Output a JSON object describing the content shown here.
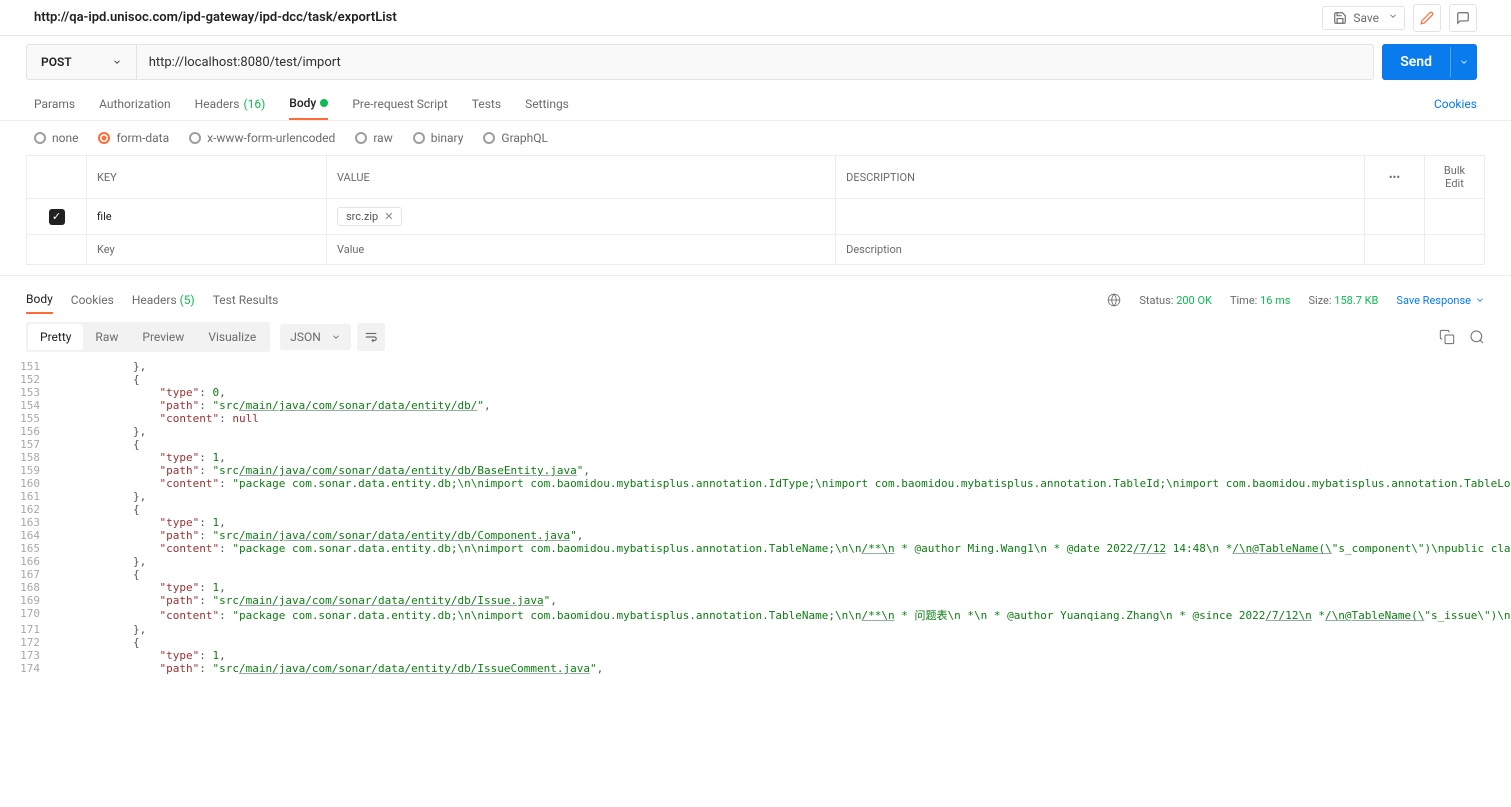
{
  "tab_title": "http://qa-ipd.unisoc.com/ipd-gateway/ipd-dcc/task/exportList",
  "save_button": "Save",
  "method": "POST",
  "url": "http://localhost:8080/test/import",
  "send_button": "Send",
  "request_tabs": {
    "params": "Params",
    "authorization": "Authorization",
    "headers": "Headers",
    "headers_count": "(16)",
    "body": "Body",
    "prerequest": "Pre-request Script",
    "tests": "Tests",
    "settings": "Settings"
  },
  "cookies_link": "Cookies",
  "body_types": {
    "none": "none",
    "formdata": "form-data",
    "urlencoded": "x-www-form-urlencoded",
    "raw": "raw",
    "binary": "binary",
    "graphql": "GraphQL"
  },
  "form_headers": {
    "key": "KEY",
    "value": "VALUE",
    "desc": "DESCRIPTION"
  },
  "bulk_edit": "Bulk Edit",
  "form_rows": [
    {
      "key": "file",
      "file": "src.zip"
    }
  ],
  "placeholders": {
    "key": "Key",
    "value": "Value",
    "desc": "Description"
  },
  "response_tabs": {
    "body": "Body",
    "cookies": "Cookies",
    "headers": "Headers",
    "headers_count": "(5)",
    "tests": "Test Results"
  },
  "status_label": "Status:",
  "status_value": "200 OK",
  "time_label": "Time:",
  "time_value": "16 ms",
  "size_label": "Size:",
  "size_value": "158.7 KB",
  "save_response": "Save Response",
  "view_segments": {
    "pretty": "Pretty",
    "raw": "Raw",
    "preview": "Preview",
    "visualize": "Visualize"
  },
  "format": "JSON",
  "code_lines": [
    {
      "n": 151,
      "indent": 2,
      "type": "close"
    },
    {
      "n": 152,
      "indent": 2,
      "type": "open"
    },
    {
      "n": 153,
      "indent": 3,
      "type": "kv_num",
      "key": "type",
      "val": "0"
    },
    {
      "n": 154,
      "indent": 3,
      "type": "kv_path",
      "key": "path",
      "prefix": "src",
      "underlined": "/main/java/com/sonar/data/entity/db/"
    },
    {
      "n": 155,
      "indent": 3,
      "type": "kv_null",
      "key": "content"
    },
    {
      "n": 156,
      "indent": 2,
      "type": "close"
    },
    {
      "n": 157,
      "indent": 2,
      "type": "open"
    },
    {
      "n": 158,
      "indent": 3,
      "type": "kv_num",
      "key": "type",
      "val": "1"
    },
    {
      "n": 159,
      "indent": 3,
      "type": "kv_path",
      "key": "path",
      "prefix": "src",
      "underlined": "/main/java/com/sonar/data/entity/db/BaseEntity.java"
    },
    {
      "n": 160,
      "indent": 3,
      "type": "kv_str",
      "key": "content",
      "val": "package com.sonar.data.entity.db;\\n\\nimport com.baomidou.mybatisplus.annotation.IdType;\\nimport com.baomidou.mybatisplus.annotation.TableId;\\nimport com.baomidou.mybatisplus.annotation.TableLogic;",
      "trail": true
    },
    {
      "n": 161,
      "indent": 2,
      "type": "close"
    },
    {
      "n": 162,
      "indent": 2,
      "type": "open"
    },
    {
      "n": 163,
      "indent": 3,
      "type": "kv_num",
      "key": "type",
      "val": "1"
    },
    {
      "n": 164,
      "indent": 3,
      "type": "kv_path",
      "key": "path",
      "prefix": "src",
      "underlined": "/main/java/com/sonar/data/entity/db/Component.java"
    },
    {
      "n": 165,
      "indent": 3,
      "type": "kv_content_mixed",
      "key": "content",
      "parts": [
        {
          "t": "s",
          "v": "package com.sonar.data.entity.db;\\n\\nimport com.baomidou.mybatisplus.annotation.TableName;\\n\\n"
        },
        {
          "t": "u",
          "v": "/**\\n"
        },
        {
          "t": "s",
          "v": " * @author Ming.Wang1\\n * @date 2022"
        },
        {
          "t": "u",
          "v": "/7/12"
        },
        {
          "t": "s",
          "v": " 14:48\\n *"
        },
        {
          "t": "u",
          "v": "/\\n@TableName(\\"
        },
        {
          "t": "s",
          "v": "\"s_component\\\")\\npublic class C"
        }
      ]
    },
    {
      "n": 166,
      "indent": 2,
      "type": "close"
    },
    {
      "n": 167,
      "indent": 2,
      "type": "open"
    },
    {
      "n": 168,
      "indent": 3,
      "type": "kv_num",
      "key": "type",
      "val": "1"
    },
    {
      "n": 169,
      "indent": 3,
      "type": "kv_path",
      "key": "path",
      "prefix": "src",
      "underlined": "/main/java/com/sonar/data/entity/db/Issue.java"
    },
    {
      "n": 170,
      "indent": 3,
      "type": "kv_content_mixed",
      "key": "content",
      "parts": [
        {
          "t": "s",
          "v": "package com.sonar.data.entity.db;\\n\\nimport com.baomidou.mybatisplus.annotation.TableName;\\n\\n"
        },
        {
          "t": "u",
          "v": "/**\\n"
        },
        {
          "t": "s",
          "v": " * 问题表\\n *\\n * @author Yuanqiang.Zhang\\n * @since 2022"
        },
        {
          "t": "u",
          "v": "/7/12\\n"
        },
        {
          "t": "s",
          "v": " *"
        },
        {
          "t": "u",
          "v": "/\\n@TableName(\\"
        },
        {
          "t": "s",
          "v": "\"s_issue\\\")\\npub"
        }
      ]
    },
    {
      "n": 171,
      "indent": 2,
      "type": "close"
    },
    {
      "n": 172,
      "indent": 2,
      "type": "open"
    },
    {
      "n": 173,
      "indent": 3,
      "type": "kv_num",
      "key": "type",
      "val": "1"
    },
    {
      "n": 174,
      "indent": 3,
      "type": "kv_path",
      "key": "path",
      "prefix": "src",
      "underlined": "/main/java/com/sonar/data/entity/db/IssueComment.java"
    }
  ]
}
